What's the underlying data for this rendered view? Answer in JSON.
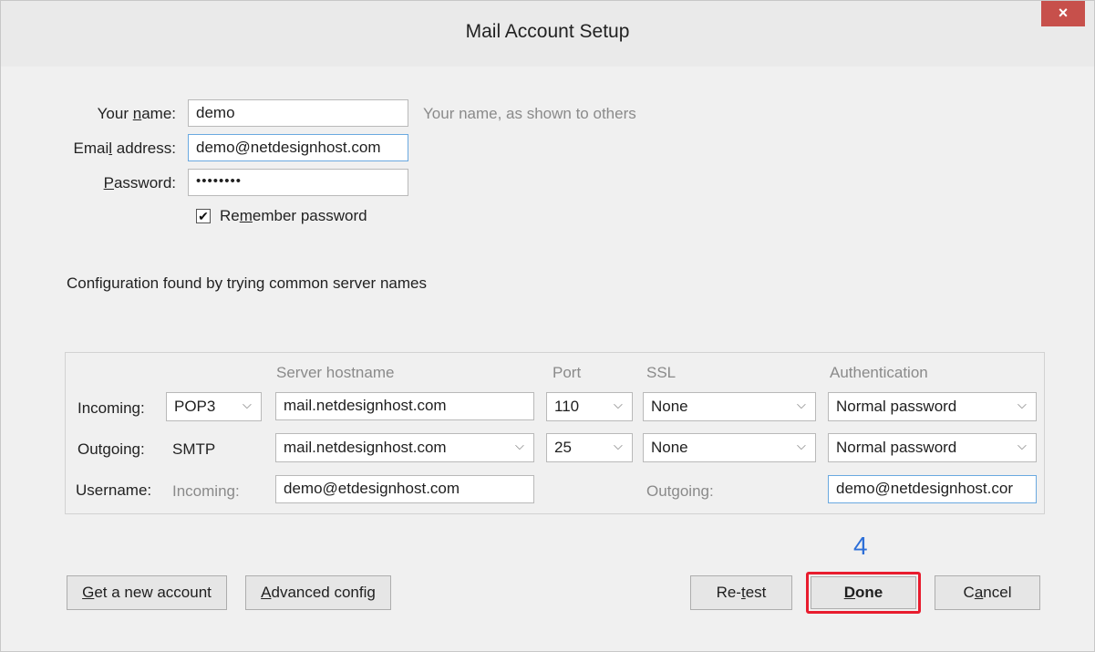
{
  "window": {
    "title": "Mail Account Setup",
    "close_glyph": "×"
  },
  "account": {
    "name_label": "Your name:",
    "name_value": "demo",
    "name_hint": "Your name, as shown to others",
    "email_label": "Email address:",
    "email_value": "demo@netdesignhost.com",
    "password_label": "Password:",
    "password_value": "••••••••",
    "remember_label": "Remember password",
    "remember_checked": true
  },
  "status_message": "Configuration found by trying common server names",
  "server_table": {
    "headers": {
      "hostname": "Server hostname",
      "port": "Port",
      "ssl": "SSL",
      "auth": "Authentication"
    },
    "incoming": {
      "label": "Incoming:",
      "protocol": "POP3",
      "hostname": "mail.netdesignhost.com",
      "port": "110",
      "ssl": "None",
      "auth": "Normal password"
    },
    "outgoing": {
      "label": "Outgoing:",
      "protocol": "SMTP",
      "hostname": "mail.netdesignhost.com",
      "port": "25",
      "ssl": "None",
      "auth": "Normal password"
    },
    "username": {
      "label": "Username:",
      "incoming_label": "Incoming:",
      "incoming_value": "demo@etdesignhost.com",
      "outgoing_label": "Outgoing:",
      "outgoing_value": "demo@netdesignhost.cor"
    }
  },
  "buttons": {
    "new_account": "Get a new account",
    "advanced": "Advanced config",
    "retest": "Re-test",
    "done": "Done",
    "cancel": "Cancel"
  },
  "annotation": {
    "step_number": "4"
  },
  "colors": {
    "highlight": "#e81c2e",
    "step": "#2d6fd8",
    "close": "#c7504b"
  },
  "icons": [
    "close-icon",
    "chevron-down-icon",
    "checkmark-icon"
  ]
}
